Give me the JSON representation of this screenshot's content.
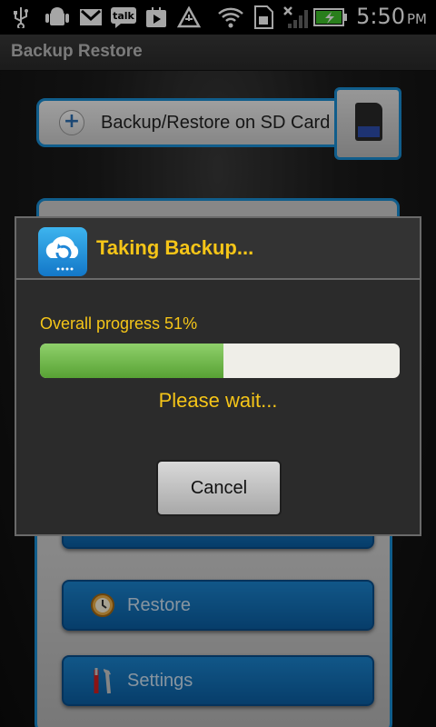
{
  "status_bar": {
    "icons": [
      "usb-icon",
      "android-debug-icon",
      "gmail-icon",
      "talk-icon",
      "play-store-icon",
      "airplane-triangle-icon",
      "wifi-icon",
      "sim-icon",
      "no-signal-icon",
      "battery-charging-icon"
    ],
    "time": "5:50",
    "ampm": "PM"
  },
  "app": {
    "title": "Backup Restore",
    "sd_button_label": "Backup/Restore on SD Card",
    "menu": [
      {
        "label": "Restore",
        "icon": "clock-icon"
      },
      {
        "label": "Settings",
        "icon": "tools-icon"
      }
    ]
  },
  "dialog": {
    "title": "Taking Backup...",
    "progress_label": "Overall progress 51%",
    "progress_fraction": 0.51,
    "status": "Please wait...",
    "cancel_label": "Cancel"
  },
  "colors": {
    "accent_blue": "#1a8fd6",
    "dialog_text": "#f5c518",
    "progress_fill": "#6bb845"
  }
}
